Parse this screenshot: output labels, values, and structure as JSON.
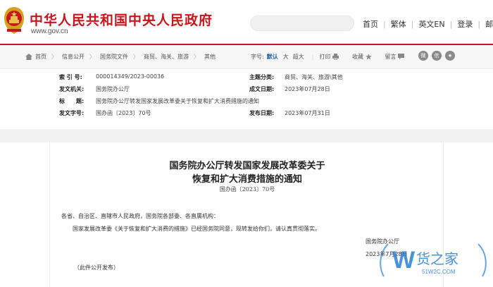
{
  "header": {
    "site_title": "中华人民共和国中央人民政府",
    "site_url": "www.gov.cn",
    "nav": [
      "首页",
      "繁体",
      "英文EN",
      "登录",
      "邮箱"
    ]
  },
  "breadcrumb": {
    "items": [
      "首页",
      "信息公开",
      "国务院文件",
      "商贸、海关、旅游",
      "其他"
    ]
  },
  "tools": {
    "font_label": "字号:",
    "font_default": "默认",
    "font_large": "大",
    "font_xlarge": "超大",
    "print": "打印",
    "favorite": "收藏",
    "comment": "留言"
  },
  "meta": {
    "index_label": "索 引 号:",
    "index_value": "000014349/2023-00036",
    "subject_label": "主题分类:",
    "subject_value": "商贸、海关、旅游\\其他",
    "issuer_label": "发文机关:",
    "issuer_value": "国务院办公厅",
    "created_label": "成文日期:",
    "created_value": "2023年07月28日",
    "title_label": "标　　题:",
    "title_value": "国务院办公厅转发国家发展改革委关于恢复和扩大消费措施的通知",
    "docno_label": "发文字号:",
    "docno_value": "国办函〔2023〕70号",
    "published_label": "发布日期:",
    "published_value": "2023年07月31日"
  },
  "document": {
    "title_line1": "国务院办公厅转发国家发展改革委关于",
    "title_line2": "恢复和扩大消费措施的通知",
    "doc_number": "国办函〔2023〕70号",
    "salutation": "各省、自治区、直辖市人民政府，国务院各部委、各直属机构：",
    "body": "国家发展改革委《关于恢复和扩大消费的措施》已经国务院同意，现转发给你们，请认真贯彻落实。",
    "signature": "国务院办公厅",
    "date": "2023年7月28日",
    "note": "（此件公开发布）"
  },
  "watermark": {
    "brand": "货之家",
    "url": "51W2C.COM"
  },
  "colors": {
    "brand_red": "#c8161d",
    "link_blue": "#1a5aa8",
    "watermark_blue": "#2a7fd4"
  }
}
